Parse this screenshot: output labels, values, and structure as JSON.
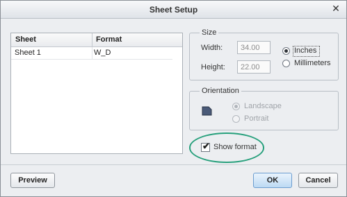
{
  "window": {
    "title": "Sheet Setup"
  },
  "sheet_table": {
    "columns": [
      "Sheet",
      "Format"
    ],
    "rows": [
      {
        "sheet": "Sheet 1",
        "format": "W_D"
      }
    ]
  },
  "size": {
    "legend": "Size",
    "width_label": "Width:",
    "width_value": "34.00",
    "height_label": "Height:",
    "height_value": "22.00",
    "units": [
      {
        "label": "Inches",
        "selected": true
      },
      {
        "label": "Millimeters",
        "selected": false
      }
    ]
  },
  "orientation": {
    "legend": "Orientation",
    "options": [
      {
        "label": "Landscape",
        "selected": true,
        "enabled": false
      },
      {
        "label": "Portrait",
        "selected": false,
        "enabled": false
      }
    ]
  },
  "show_format": {
    "label": "Show format",
    "checked": true
  },
  "buttons": {
    "preview": "Preview",
    "ok": "OK",
    "cancel": "Cancel"
  },
  "colors": {
    "highlight": "#27a07c",
    "ok_button": "#bcd9f3"
  }
}
